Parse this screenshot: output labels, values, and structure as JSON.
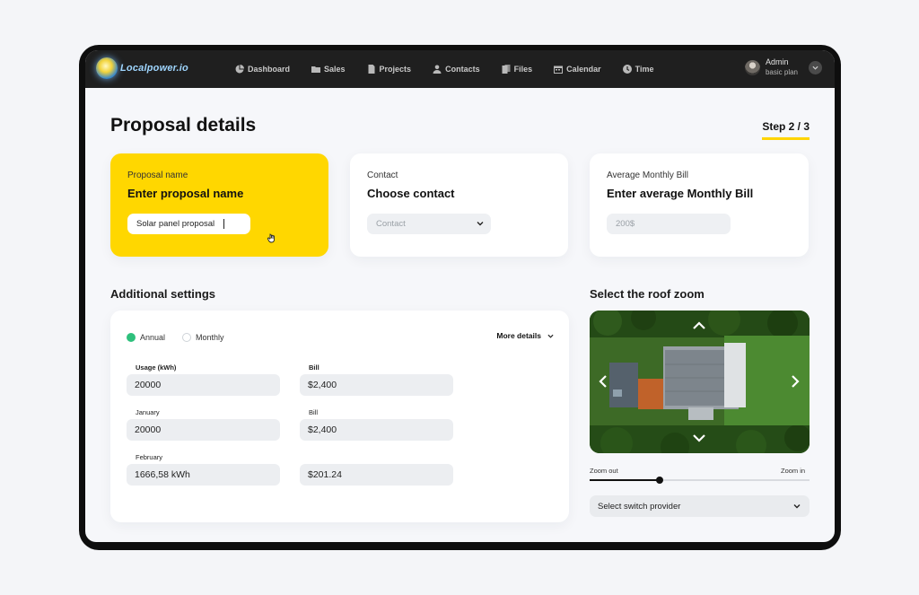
{
  "app": {
    "logo_text": "Localpower.io"
  },
  "nav": {
    "items": [
      {
        "label": "Dashboard",
        "icon": "pie-chart-icon"
      },
      {
        "label": "Sales",
        "icon": "folder-icon"
      },
      {
        "label": "Projects",
        "icon": "document-icon"
      },
      {
        "label": "Contacts",
        "icon": "person-icon"
      },
      {
        "label": "Files",
        "icon": "files-icon"
      },
      {
        "label": "Calendar",
        "icon": "calendar-icon"
      },
      {
        "label": "Time",
        "icon": "clock-icon"
      }
    ]
  },
  "user": {
    "name": "Admin",
    "plan": "basic plan"
  },
  "page": {
    "title": "Proposal details",
    "step": "Step 2 / 3"
  },
  "cards": {
    "proposal": {
      "label": "Proposal name",
      "heading": "Enter proposal name",
      "value": "Solar panel proposal"
    },
    "contact": {
      "label": "Contact",
      "heading": "Choose contact",
      "placeholder": "Contact"
    },
    "bill": {
      "label": "Average Monthly Bill",
      "heading": "Enter average Monthly Bill",
      "placeholder": "200$"
    }
  },
  "settings": {
    "title": "Additional settings",
    "radios": {
      "annual": "Annual",
      "monthly": "Monthly",
      "selected": "annual"
    },
    "more_details": "More details",
    "rows": [
      {
        "left_label": "Usage (kWh)",
        "left_value": "20000",
        "right_label": "Bill",
        "right_value": "$2,400"
      },
      {
        "left_label": "January",
        "left_value": "20000",
        "right_label": "Bill",
        "right_value": "$2,400"
      },
      {
        "left_label": "February",
        "left_value": "1666,58 kWh",
        "right_label": "",
        "right_value": "$201.24"
      }
    ]
  },
  "roof": {
    "title": "Select the roof zoom",
    "zoom_out": "Zoom out",
    "zoom_in": "Zoom in",
    "zoom_level": 0.32,
    "provider_placeholder": "Select switch provider"
  },
  "colors": {
    "accent": "#ffd700",
    "nav_bg": "#1f1f1f",
    "radio_on": "#2ec07c"
  }
}
